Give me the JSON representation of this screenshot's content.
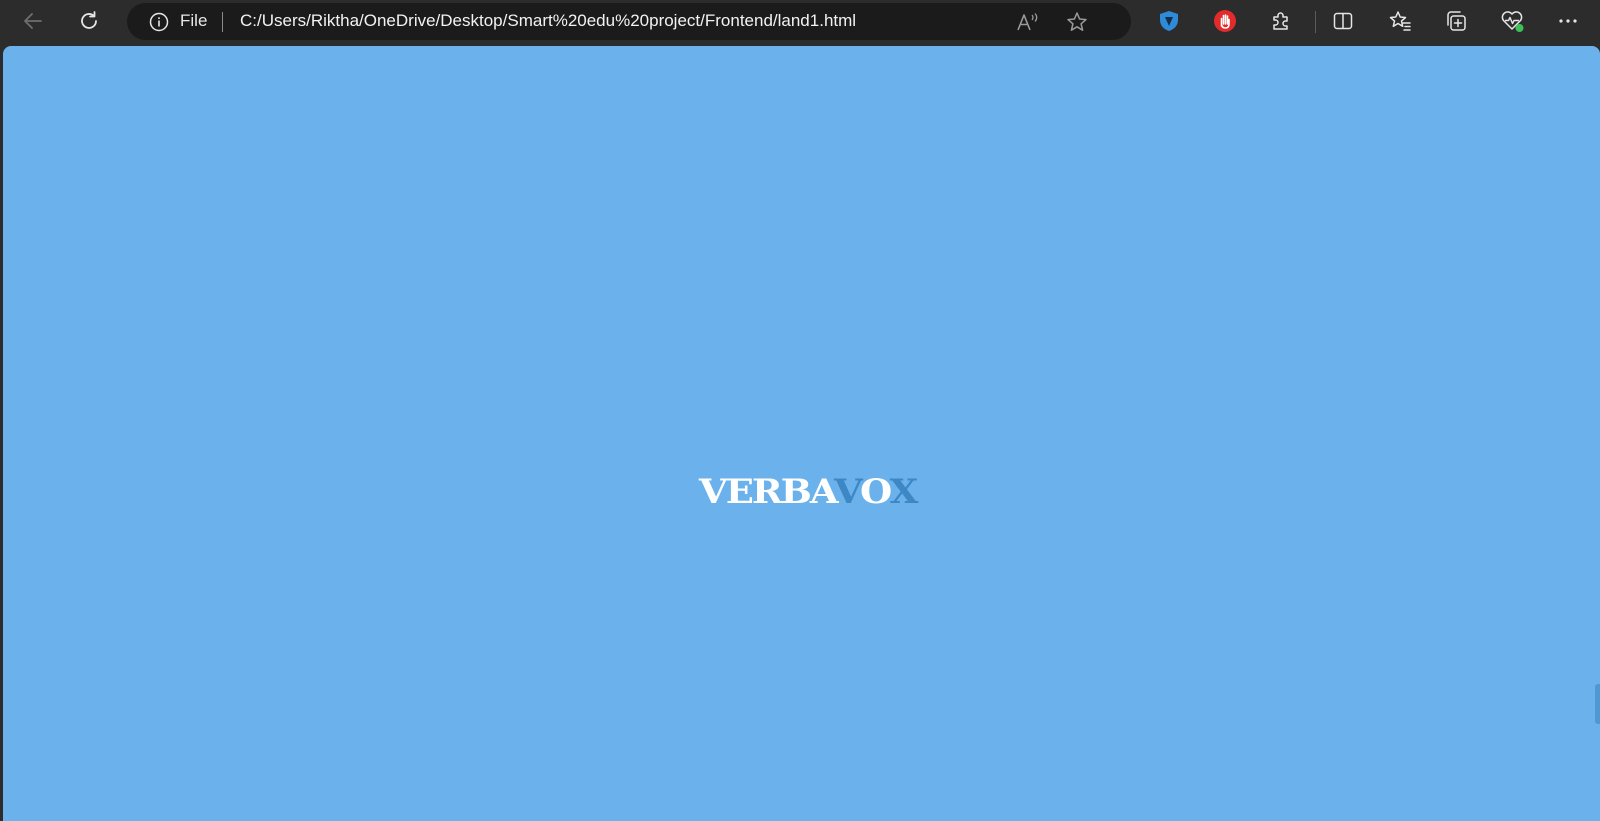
{
  "toolbar": {
    "back_icon": "back-arrow-icon",
    "refresh_icon": "refresh-icon",
    "address": {
      "info_icon": "info-icon",
      "scheme_label": "File",
      "url": "C:/Users/Riktha/OneDrive/Desktop/Smart%20edu%20project/Frontend/land1.html",
      "read_aloud_icon": "read-aloud-icon",
      "favorite_icon": "star-icon"
    },
    "extensions": [
      {
        "name": "shield-extension-icon",
        "color": "#2f8ad8"
      },
      {
        "name": "red-hand-extension-icon",
        "color": "#e22b2b"
      },
      {
        "name": "extensions-puzzle-icon"
      }
    ],
    "right_icons": [
      "split-screen-icon",
      "favorites-icon",
      "collections-icon",
      "browser-essentials-icon",
      "more-menu-icon"
    ]
  },
  "page": {
    "background_color": "#6bb2ed",
    "logo": {
      "part1": "VERBA",
      "part2": "V",
      "part3": "O",
      "part4": "X",
      "color_light": "#ffffff",
      "color_dark": "#3d88c4"
    }
  }
}
